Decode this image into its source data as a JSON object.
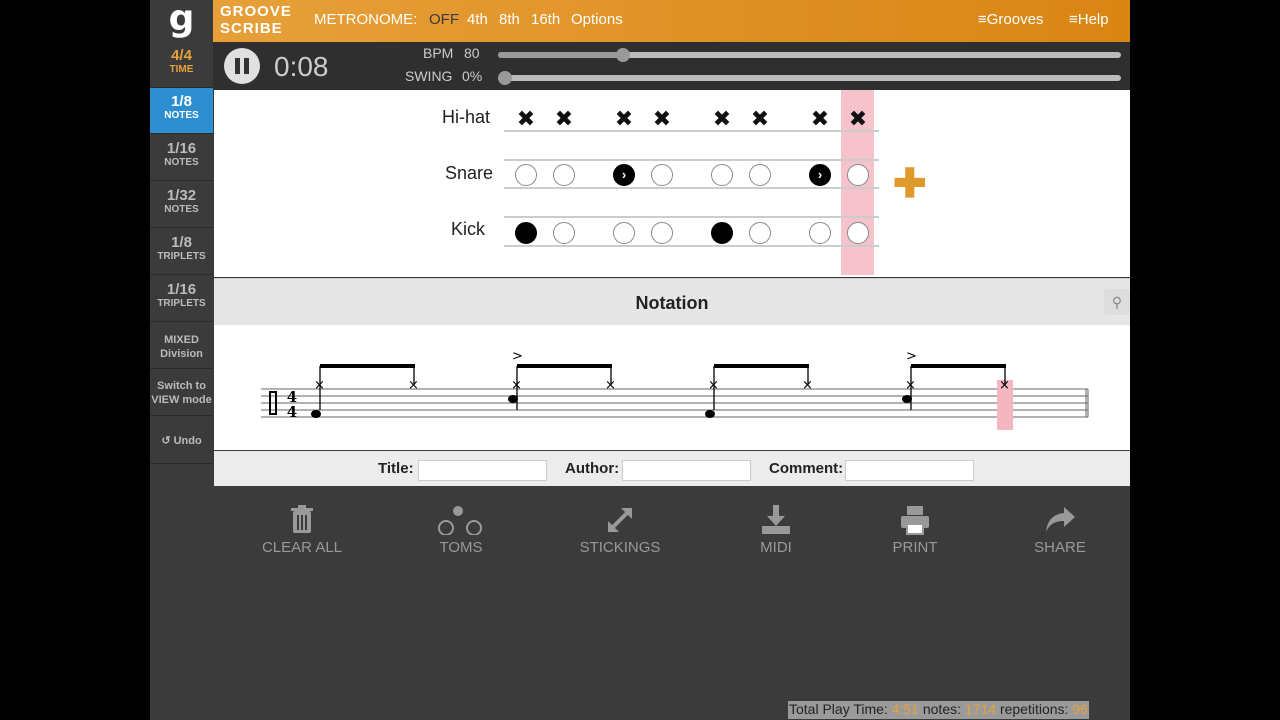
{
  "header": {
    "logo": "g",
    "brand_line1": "GROOVE",
    "brand_line2": "SCRIBE",
    "metronome_label": "METRONOME:",
    "metronome_options": [
      "OFF",
      "4th",
      "8th",
      "16th",
      "Options"
    ],
    "metronome_selected": "OFF",
    "nav": {
      "grooves": "≡Grooves",
      "help": "≡Help"
    },
    "accent_color": "#e8a23c"
  },
  "sidebar": {
    "items": [
      {
        "num": "4",
        "den": "4",
        "label": "TIME"
      },
      {
        "num": "1",
        "den": "8",
        "label": "NOTES",
        "active": true
      },
      {
        "num": "1",
        "den": "16",
        "label": "NOTES"
      },
      {
        "num": "1",
        "den": "32",
        "label": "NOTES"
      },
      {
        "num": "1",
        "den": "8",
        "label": "TRIPLETS"
      },
      {
        "num": "1",
        "den": "16",
        "label": "TRIPLETS"
      }
    ],
    "mixed_1": "MIXED",
    "mixed_2": "Division",
    "switch_1": "Switch to",
    "switch_2": "VIEW mode",
    "undo": "↺ Undo"
  },
  "player": {
    "time": "0:08",
    "bpm_label": "BPM",
    "bpm_value": "80",
    "swing_label": "SWING",
    "swing_value": "0%",
    "bpm_fraction": 0.2,
    "swing_fraction": 0.0
  },
  "grid": {
    "hihat_label": "Hi-hat",
    "snare_label": "Snare",
    "kick_label": "Kick",
    "hihat": [
      "x",
      "x",
      "x",
      "x",
      "x",
      "x",
      "x",
      "x"
    ],
    "snare": [
      "o",
      "o",
      "accent",
      "o",
      "o",
      "o",
      "accent",
      "o"
    ],
    "kick": [
      "filled",
      "o",
      "o",
      "o",
      "filled",
      "o",
      "o",
      "o"
    ],
    "current_step": 8
  },
  "notation": {
    "title": "Notation",
    "time_sig_top": "4",
    "time_sig_bottom": "4",
    "accent_mark": ">"
  },
  "meta": {
    "title_label": "Title:",
    "author_label": "Author:",
    "comment_label": "Comment:",
    "title_value": "",
    "author_value": "",
    "comment_value": ""
  },
  "toolbar": {
    "clear_all": "CLEAR ALL",
    "toms": "TOMS",
    "stickings": "STICKINGS",
    "midi": "MIDI",
    "print": "PRINT",
    "share": "SHARE"
  },
  "stats": {
    "play_label": "Total Play Time:",
    "play_value": "4:51",
    "notes_label": "notes:",
    "notes_value": "1714",
    "reps_label": "repetitions:",
    "reps_value": "96"
  }
}
